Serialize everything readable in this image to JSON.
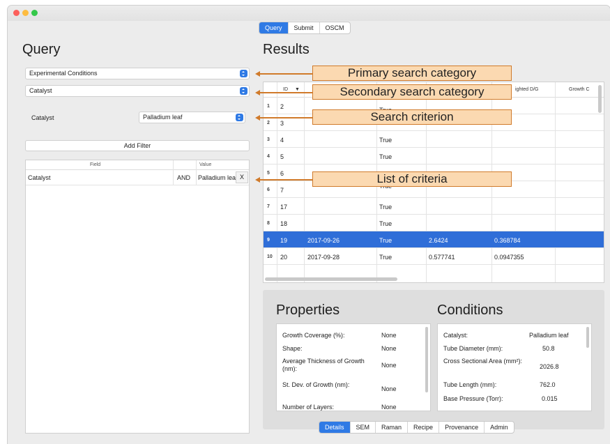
{
  "top_tabs": [
    {
      "label": "Query",
      "active": true
    },
    {
      "label": "Submit",
      "active": false
    },
    {
      "label": "OSCM",
      "active": false
    }
  ],
  "query": {
    "title": "Query",
    "primary_category": "Experimental Conditions",
    "secondary_category": "Catalyst",
    "criterion_label": "Catalyst",
    "criterion_value": "Palladium leaf",
    "add_filter_label": "Add Filter",
    "criteria_table": {
      "headers": [
        "Field",
        "Value"
      ],
      "rows": [
        {
          "field": "Catalyst",
          "op": "AND",
          "value": "Palladium leaf",
          "remove": "X"
        }
      ]
    }
  },
  "results": {
    "title": "Results",
    "headers": [
      "ID",
      "▼",
      "",
      "",
      "",
      "ighted D/G",
      "Growth C"
    ],
    "rows": [
      {
        "n": "1",
        "id": "2",
        "date": "",
        "flag": "True",
        "v1": "",
        "v2": ""
      },
      {
        "n": "2",
        "id": "3",
        "date": "",
        "flag": "",
        "v1": "",
        "v2": ""
      },
      {
        "n": "3",
        "id": "4",
        "date": "",
        "flag": "True",
        "v1": "",
        "v2": ""
      },
      {
        "n": "4",
        "id": "5",
        "date": "",
        "flag": "True",
        "v1": "",
        "v2": ""
      },
      {
        "n": "5",
        "id": "6",
        "date": "",
        "flag": "",
        "v1": "",
        "v2": ""
      },
      {
        "n": "6",
        "id": "7",
        "date": "",
        "flag": "True",
        "v1": "",
        "v2": ""
      },
      {
        "n": "7",
        "id": "17",
        "date": "",
        "flag": "True",
        "v1": "",
        "v2": ""
      },
      {
        "n": "8",
        "id": "18",
        "date": "",
        "flag": "True",
        "v1": "",
        "v2": ""
      },
      {
        "n": "9",
        "id": "19",
        "date": "2017-09-26",
        "flag": "True",
        "v1": "2.6424",
        "v2": "0.368784"
      },
      {
        "n": "10",
        "id": "20",
        "date": "2017-09-28",
        "flag": "True",
        "v1": "0.577741",
        "v2": "0.0947355"
      }
    ],
    "selected_row": 8
  },
  "properties": {
    "title": "Properties",
    "items": [
      {
        "key": "Growth Coverage (%):",
        "value": "None"
      },
      {
        "key": "Shape:",
        "value": "None"
      },
      {
        "key": "Average Thickness of Growth (nm):",
        "value": "None"
      },
      {
        "key": "St. Dev. of Growth (nm):",
        "value": "None"
      },
      {
        "key": "Number of Layers:",
        "value": "None"
      }
    ]
  },
  "conditions": {
    "title": "Conditions",
    "items": [
      {
        "key": "Catalyst:",
        "value": "Palladium leaf"
      },
      {
        "key": "Tube Diameter (mm):",
        "value": "50.8"
      },
      {
        "key": "Cross Sectional Area (mm²):",
        "value": "2026.8"
      },
      {
        "key": "Tube Length (mm):",
        "value": "762.0"
      },
      {
        "key": "Base Pressure (Torr):",
        "value": "0.015"
      }
    ]
  },
  "bottom_tabs": [
    {
      "label": "Details",
      "active": true
    },
    {
      "label": "SEM",
      "active": false
    },
    {
      "label": "Raman",
      "active": false
    },
    {
      "label": "Recipe",
      "active": false
    },
    {
      "label": "Provenance",
      "active": false
    },
    {
      "label": "Admin",
      "active": false
    }
  ],
  "annotations": {
    "primary": "Primary search category",
    "secondary": "Secondary search category",
    "criterion": "Search criterion",
    "list": "List of criteria"
  },
  "colors": {
    "accent": "#2f7ae5",
    "selected_row": "#2f6ed8",
    "callout_fill": "#fbd9b1",
    "callout_border": "#d07a2a"
  }
}
